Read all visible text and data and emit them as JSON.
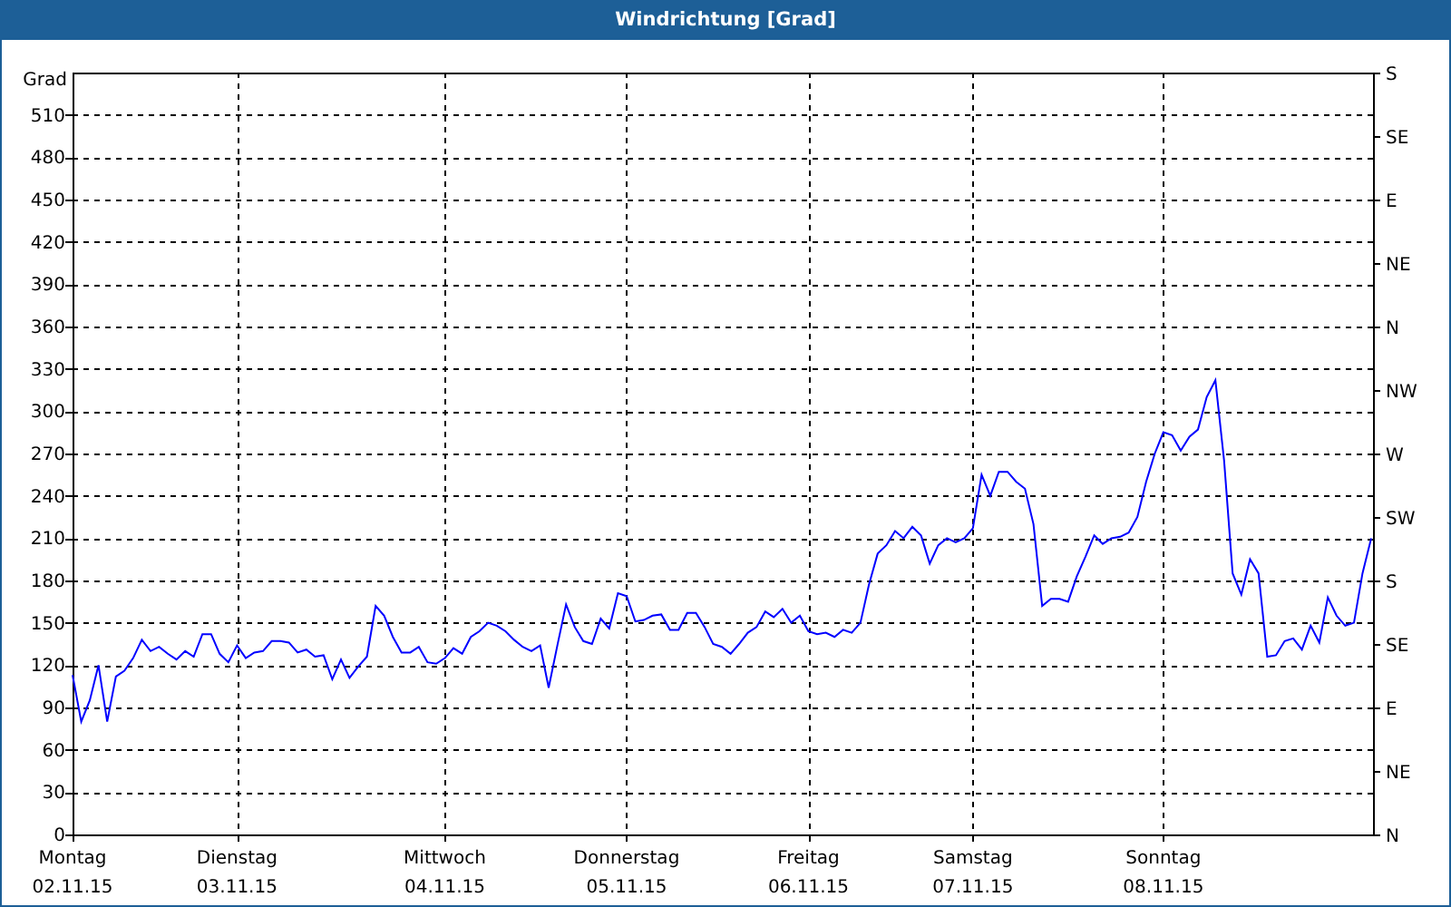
{
  "window": {
    "title": "Windrichtung [Grad]"
  },
  "chart_data": {
    "type": "line",
    "grid": true,
    "ylabel": "Grad",
    "ylim": [
      0,
      540
    ],
    "yticks": [
      0,
      30,
      60,
      90,
      120,
      150,
      180,
      210,
      240,
      270,
      300,
      330,
      360,
      390,
      420,
      450,
      480,
      510
    ],
    "categories": [
      "Montag\n02.11.15",
      null,
      null,
      null,
      null,
      null,
      null,
      null,
      null,
      null,
      null,
      null,
      null,
      null,
      null,
      null,
      null,
      null,
      null,
      "Dienstag\n03.11.15",
      null,
      null,
      null,
      null,
      null,
      null,
      null,
      null,
      null,
      null,
      null,
      null,
      null,
      null,
      null,
      null,
      null,
      null,
      null,
      null,
      null,
      null,
      null,
      "Mittwoch\n04.11.15",
      null,
      null,
      null,
      null,
      null,
      null,
      null,
      null,
      null,
      null,
      null,
      null,
      null,
      null,
      null,
      null,
      null,
      null,
      null,
      null,
      "Donnerstag\n05.11.15",
      null,
      null,
      null,
      null,
      null,
      null,
      null,
      null,
      null,
      null,
      null,
      null,
      null,
      null,
      null,
      null,
      null,
      null,
      null,
      null,
      "Freitag\n06.11.15",
      null,
      null,
      null,
      null,
      null,
      null,
      null,
      null,
      null,
      null,
      null,
      null,
      null,
      null,
      null,
      null,
      null,
      null,
      "Samstag\n07.11.15",
      null,
      null,
      null,
      null,
      null,
      null,
      null,
      null,
      null,
      null,
      null,
      null,
      null,
      null,
      null,
      null,
      null,
      null,
      null,
      null,
      null,
      "Sonntag\n08.11.15",
      null,
      null,
      null,
      null,
      null,
      null,
      null,
      null,
      null,
      null,
      null,
      null,
      null,
      null,
      null,
      null,
      null,
      null,
      null,
      null,
      null,
      null,
      null,
      null
    ],
    "series": [
      {
        "color": "#0000ff",
        "values": [
          113,
          80,
          95,
          120,
          80,
          112,
          116,
          125,
          138,
          130,
          133,
          128,
          124,
          130,
          126,
          142,
          142,
          128,
          122,
          134,
          125,
          129,
          130,
          137,
          137,
          136,
          129,
          131,
          126,
          127,
          110,
          124,
          111,
          119,
          126,
          162,
          155,
          140,
          129,
          129,
          133,
          122,
          121,
          125,
          132,
          128,
          140,
          144,
          150,
          148,
          144,
          138,
          133,
          130,
          134,
          104,
          134,
          163,
          147,
          137,
          135,
          153,
          146,
          171,
          169,
          151,
          152,
          155,
          156,
          145,
          145,
          157,
          157,
          147,
          135,
          133,
          128,
          135,
          143,
          147,
          158,
          154,
          160,
          150,
          155,
          144,
          142,
          143,
          140,
          145,
          143,
          150,
          177,
          199,
          205,
          215,
          210,
          218,
          212,
          192,
          205,
          210,
          207,
          210,
          217,
          255,
          240,
          257,
          257,
          250,
          245,
          220,
          162,
          167,
          167,
          165,
          183,
          197,
          212,
          206,
          210,
          211,
          214,
          225,
          250,
          270,
          285,
          283,
          272,
          282,
          287,
          310,
          322,
          265,
          185,
          170,
          195,
          185,
          126,
          127,
          137,
          139,
          131,
          148,
          136,
          168,
          155,
          148,
          150,
          185,
          210
        ]
      }
    ]
  },
  "compass_axis": {
    "labels": [
      "S",
      "SE",
      "E",
      "NE",
      "N",
      "NW",
      "W",
      "SW",
      "S",
      "SE",
      "E",
      "NE",
      "N"
    ]
  }
}
